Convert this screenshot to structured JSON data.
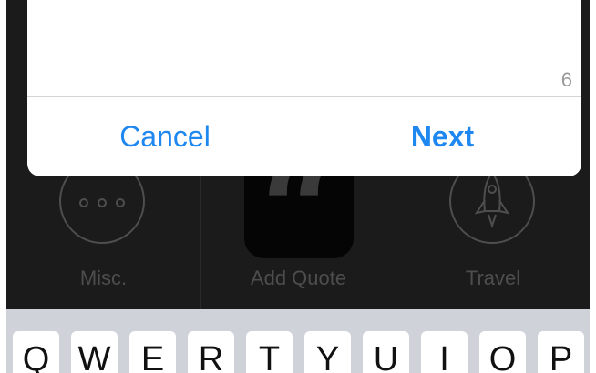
{
  "dialog": {
    "char_count": "6",
    "cancel_label": "Cancel",
    "next_label": "Next"
  },
  "categories": [
    {
      "label": "Misc.",
      "icon": "more-dots-icon"
    },
    {
      "label": "Add Quote",
      "icon": "quote-icon"
    },
    {
      "label": "Travel",
      "icon": "rocket-icon"
    }
  ],
  "keyboard": {
    "keys": [
      "Q",
      "W",
      "E",
      "R",
      "T",
      "Y",
      "U",
      "I",
      "O",
      "P"
    ]
  },
  "colors": {
    "accent": "#1e88f0",
    "overlay": "#1b1b1b",
    "keyboard_bg": "#cfd3d9"
  }
}
